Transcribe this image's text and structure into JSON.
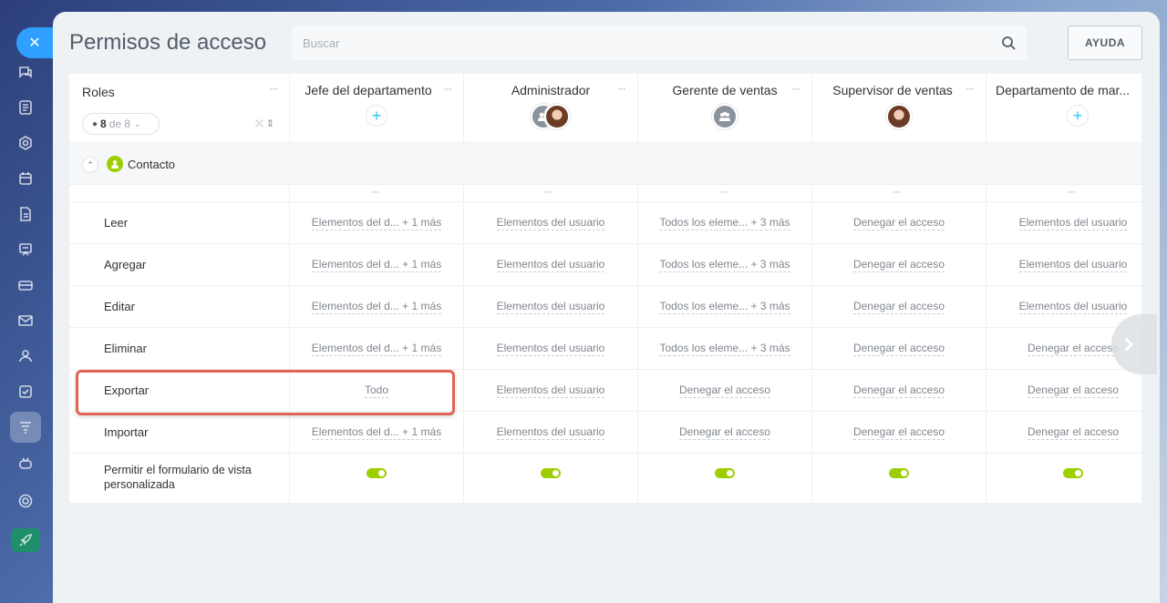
{
  "page_title": "Permisos de acceso",
  "search": {
    "placeholder": "Buscar"
  },
  "help_label": "AYUDA",
  "roles_header": {
    "label": "Roles",
    "visible_count": "8",
    "of_label": "de 8"
  },
  "columns": [
    {
      "name": "Jefe del departamento",
      "avatar": "add"
    },
    {
      "name": "Administrador",
      "avatar": "group+person"
    },
    {
      "name": "Gerente de ventas",
      "avatar": "group"
    },
    {
      "name": "Supervisor de ventas",
      "avatar": "person"
    },
    {
      "name": "Departamento de mar...",
      "avatar": "add"
    }
  ],
  "section": {
    "label": "Contacto",
    "icon": "person-icon"
  },
  "rows": [
    {
      "label": "Leer",
      "cells": [
        "Elementos del d... + 1 más",
        "Elementos del usuario",
        "Todos los eleme... + 3 más",
        "Denegar el acceso",
        "Elementos del usuario"
      ]
    },
    {
      "label": "Agregar",
      "cells": [
        "Elementos del d... + 1 más",
        "Elementos del usuario",
        "Todos los eleme... + 3 más",
        "Denegar el acceso",
        "Elementos del usuario"
      ]
    },
    {
      "label": "Editar",
      "cells": [
        "Elementos del d... + 1 más",
        "Elementos del usuario",
        "Todos los eleme... + 3 más",
        "Denegar el acceso",
        "Elementos del usuario"
      ]
    },
    {
      "label": "Eliminar",
      "cells": [
        "Elementos del d... + 1 más",
        "Elementos del usuario",
        "Todos los eleme... + 3 más",
        "Denegar el acceso",
        "Denegar el acceso"
      ]
    },
    {
      "label": "Exportar",
      "cells": [
        "Todo",
        "Elementos del usuario",
        "Denegar el acceso",
        "Denegar el acceso",
        "Denegar el acceso"
      ]
    },
    {
      "label": "Importar",
      "cells": [
        "Elementos del d... + 1 más",
        "Elementos del usuario",
        "Denegar el acceso",
        "Denegar el acceso",
        "Denegar el acceso"
      ]
    }
  ],
  "toggle_row": {
    "label": "Permitir el formulario de vista personalizada",
    "values": [
      true,
      true,
      true,
      true,
      true
    ]
  },
  "colors": {
    "accent": "#2fa0ff",
    "toggle_on": "#9dcf00",
    "highlight": "#e06454",
    "plus": "#2fc6f6"
  }
}
